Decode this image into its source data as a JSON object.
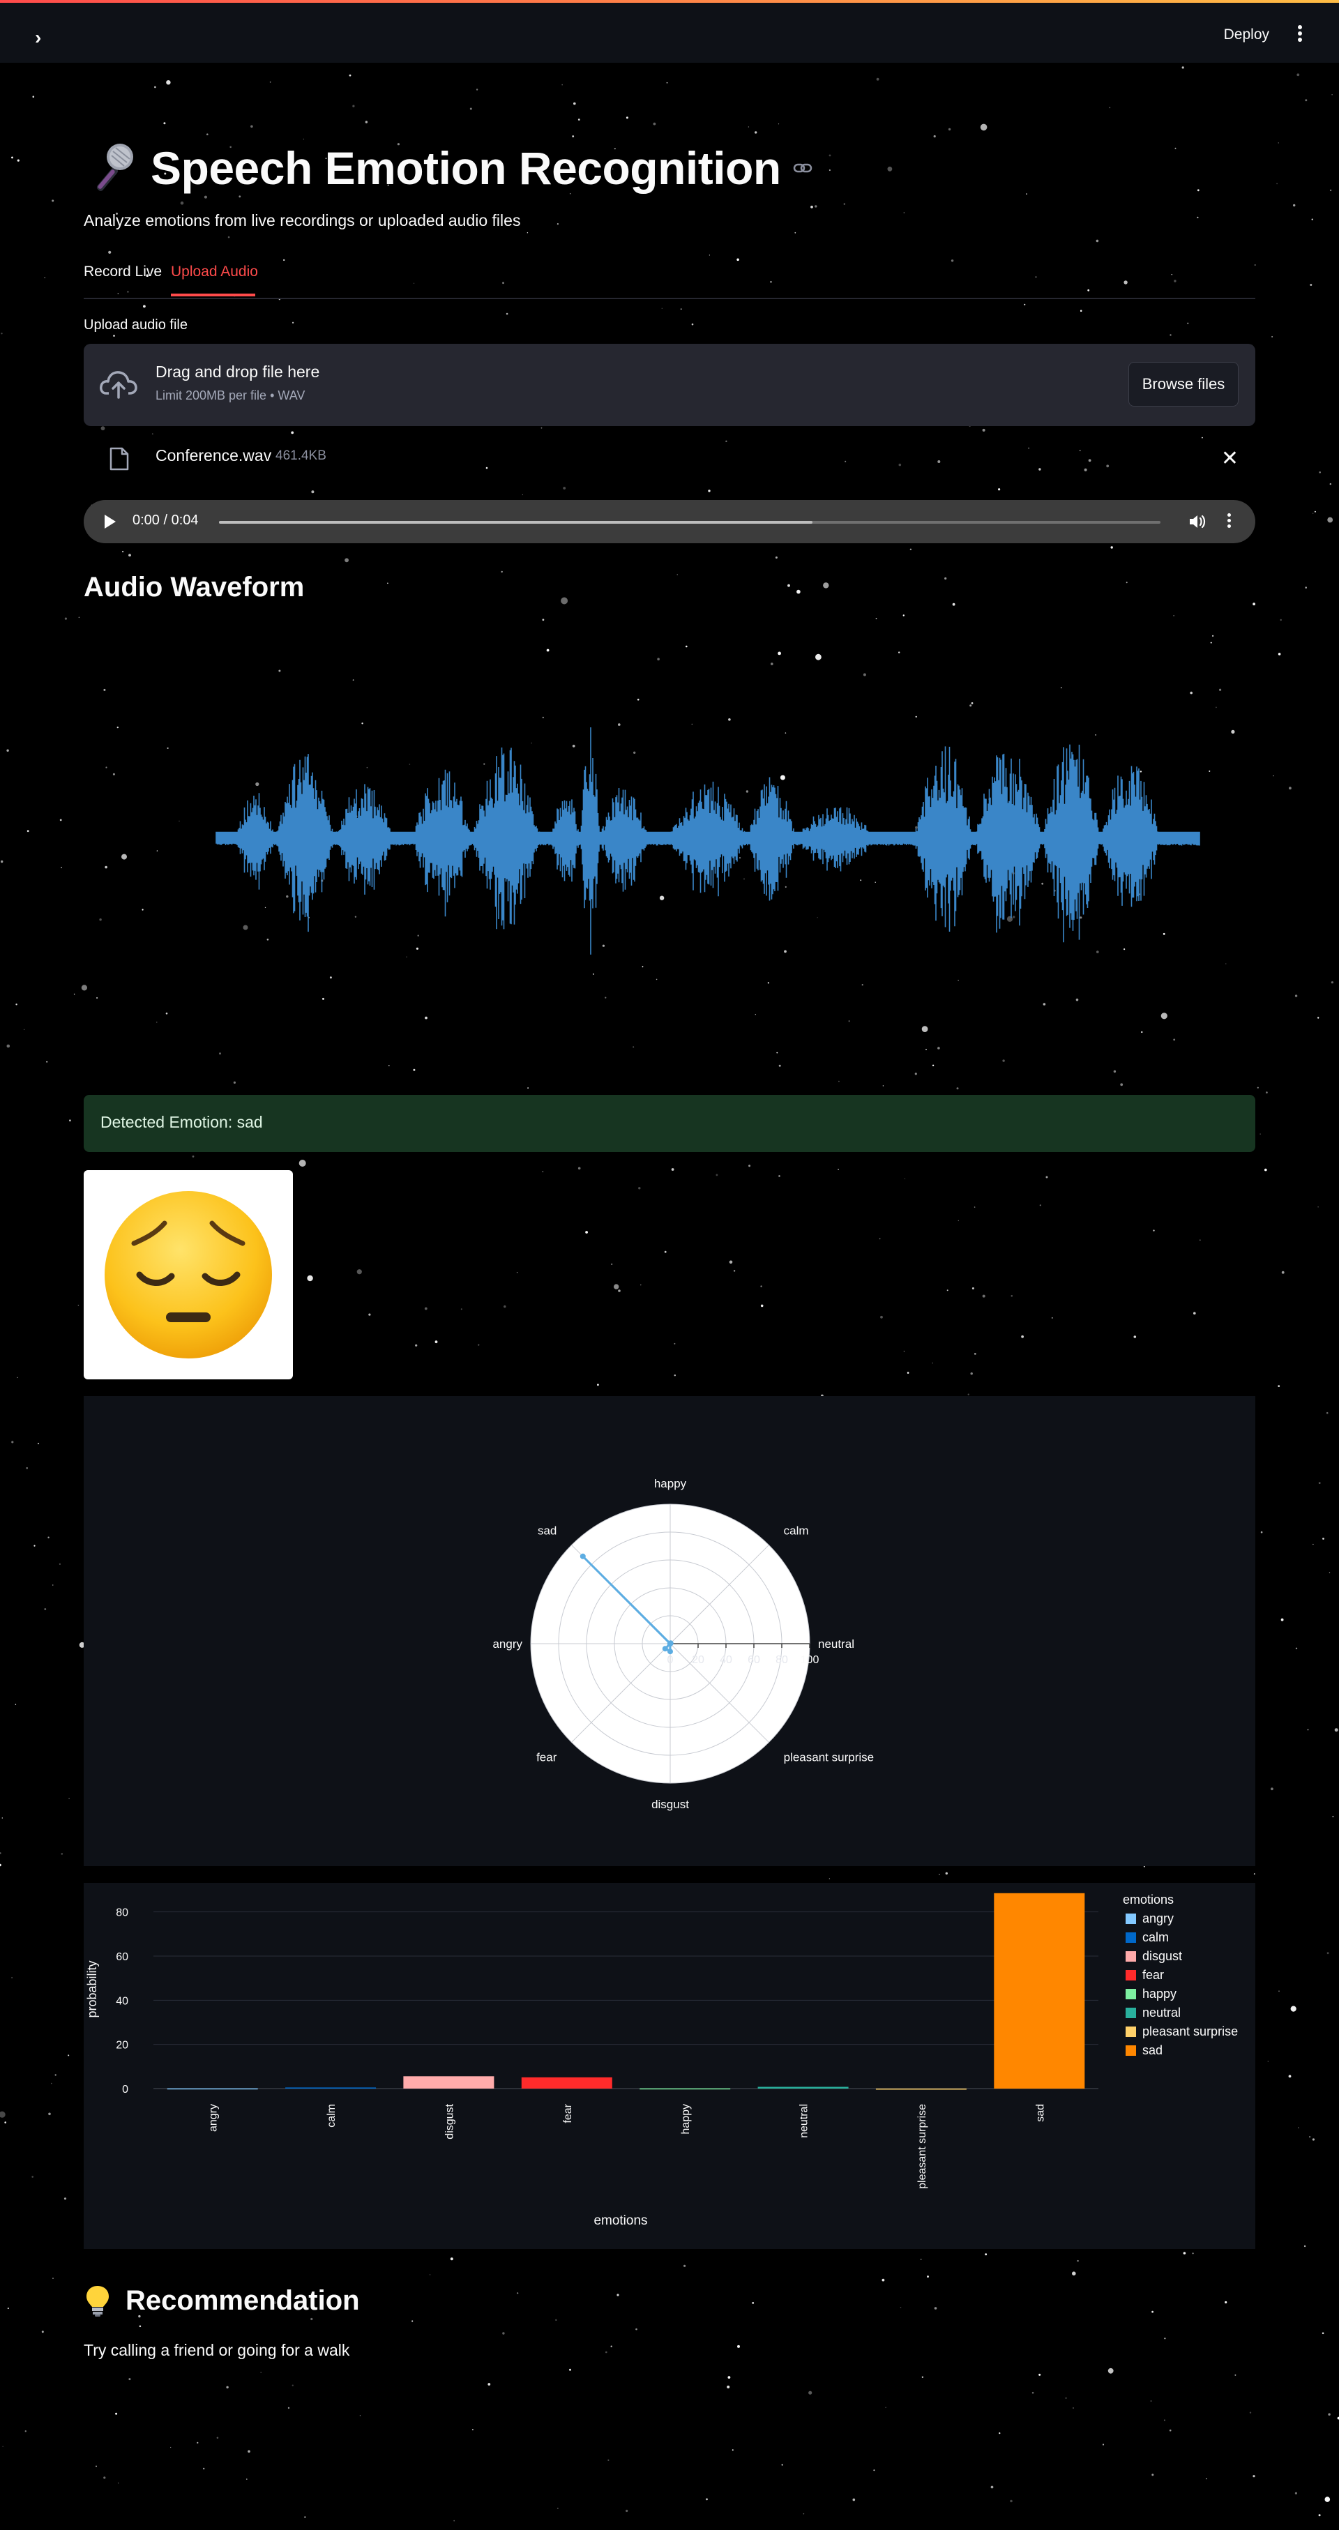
{
  "header": {
    "deploy_label": "Deploy"
  },
  "page": {
    "title": "Speech Emotion Recognition",
    "subtitle": "Analyze emotions from live recordings or uploaded audio files"
  },
  "tabs": [
    {
      "label": "Record Live",
      "active": false
    },
    {
      "label": "Upload Audio",
      "active": true
    }
  ],
  "uploader": {
    "label": "Upload audio file",
    "drop_title": "Drag and drop file here",
    "drop_sub": "Limit 200MB per file • WAV",
    "browse_label": "Browse files",
    "file": {
      "name": "Conference.wav",
      "size": "461.4KB"
    }
  },
  "audio_player": {
    "time": "0:00 / 0:04",
    "progress": 0.63
  },
  "waveform": {
    "title": "Audio Waveform",
    "color": "#3a86c8"
  },
  "result": {
    "detected_text": "Detected Emotion: sad",
    "emoji": "pensive-face"
  },
  "colors": {
    "accent": "#ff4b4b",
    "success_bg": "#173521",
    "panel_bg": "#0e1117"
  },
  "chart_data": [
    {
      "type": "radar",
      "categories": [
        "happy",
        "calm",
        "neutral",
        "pleasant surprise",
        "disgust",
        "fear",
        "angry",
        "sad"
      ],
      "values": [
        0.1,
        0.5,
        0.1,
        0.0,
        5.6,
        5.1,
        0.1,
        88.5
      ],
      "radial_range": [
        0,
        100
      ],
      "radial_ticks": [
        "0",
        "20",
        "40",
        "60",
        "80",
        "100"
      ],
      "line_color": "#5dade2"
    },
    {
      "type": "bar",
      "categories": [
        "angry",
        "calm",
        "disgust",
        "fear",
        "happy",
        "neutral",
        "pleasant surprise",
        "sad"
      ],
      "values": [
        0.1,
        0.5,
        5.6,
        5.1,
        0.1,
        0.8,
        0.0,
        88.5
      ],
      "colors": [
        "#83c9ff",
        "#0068c9",
        "#ffabab",
        "#ff2b2b",
        "#7defa1",
        "#29b09d",
        "#ffd16a",
        "#ff8700"
      ],
      "xlabel": "emotions",
      "ylabel": "probability",
      "ylim": [
        0,
        90
      ],
      "yticks": [
        0,
        20,
        40,
        60,
        80
      ],
      "legend_title": "emotions",
      "legend_position": "right"
    }
  ],
  "recommendation": {
    "title": "Recommendation",
    "text": "Try calling a friend or going for a walk"
  }
}
